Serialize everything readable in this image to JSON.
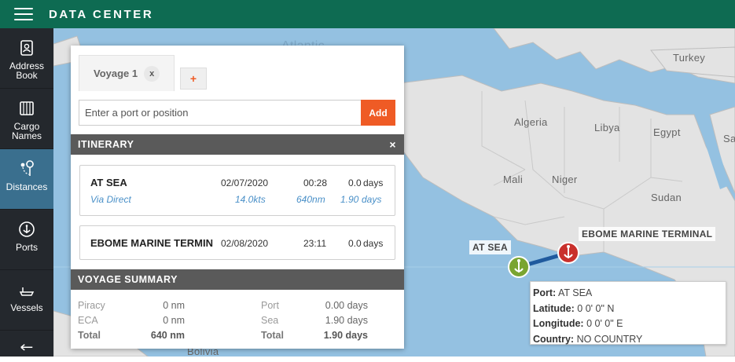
{
  "app": {
    "title": "DATA CENTER"
  },
  "sidebar": {
    "items": [
      {
        "label": "Address Book",
        "icon": "address-book-icon"
      },
      {
        "label": "Cargo Names",
        "icon": "cargo-icon"
      },
      {
        "label": "Distances",
        "icon": "distances-icon",
        "active": true
      },
      {
        "label": "Ports",
        "icon": "anchor-icon"
      },
      {
        "label": "Vessels",
        "icon": "vessel-icon"
      }
    ]
  },
  "map": {
    "countries": [
      "Turkey",
      "Algeria",
      "Libya",
      "Egypt",
      "Mali",
      "Niger",
      "Sudan",
      "Atlantic",
      "Bolivia",
      "Sa"
    ],
    "origin_tag": "AT SEA",
    "destination_tag": "EBOME MARINE TERMINAL",
    "colors": {
      "sea": "#94c1e1",
      "land": "#e3e3e3",
      "route": "#1f5a9e",
      "origin": "#7aa531",
      "destination": "#c9302c"
    }
  },
  "panel": {
    "tab_label": "Voyage 1",
    "tab_close": "x",
    "tab_add": "+",
    "input_placeholder": "Enter a port or position",
    "add_label": "Add",
    "itinerary_header": "ITINERARY",
    "itinerary_close": "×",
    "legs": [
      {
        "name": "AT SEA",
        "date": "02/07/2020",
        "time": "00:28",
        "days": "0.0",
        "days_unit": "days",
        "route": "Via Direct",
        "speed": "14.0kts",
        "distance": "640nm",
        "leg_days": "1.90",
        "leg_days_unit": "days"
      },
      {
        "name": "EBOME MARINE TERMIN",
        "date": "02/08/2020",
        "time": "23:11",
        "days": "0.0",
        "days_unit": "days"
      }
    ],
    "summary_header": "VOYAGE SUMMARY",
    "summary": {
      "piracy_label": "Piracy",
      "piracy_value": "0 nm",
      "eca_label": "ECA",
      "eca_value": "0 nm",
      "total_label": "Total",
      "total_distance": "640 nm",
      "port_label": "Port",
      "port_value": "0.00 days",
      "sea_label": "Sea",
      "sea_value": "1.90 days",
      "total2_label": "Total",
      "total_time": "1.90 days"
    }
  },
  "popup": {
    "port_label": "Port:",
    "port_value": "AT SEA",
    "lat_label": "Latitude:",
    "lat_value": "0 0' 0\" N",
    "lon_label": "Longitude:",
    "lon_value": "0 0' 0\" E",
    "country_label": "Country:",
    "country_value": "NO COUNTRY"
  }
}
